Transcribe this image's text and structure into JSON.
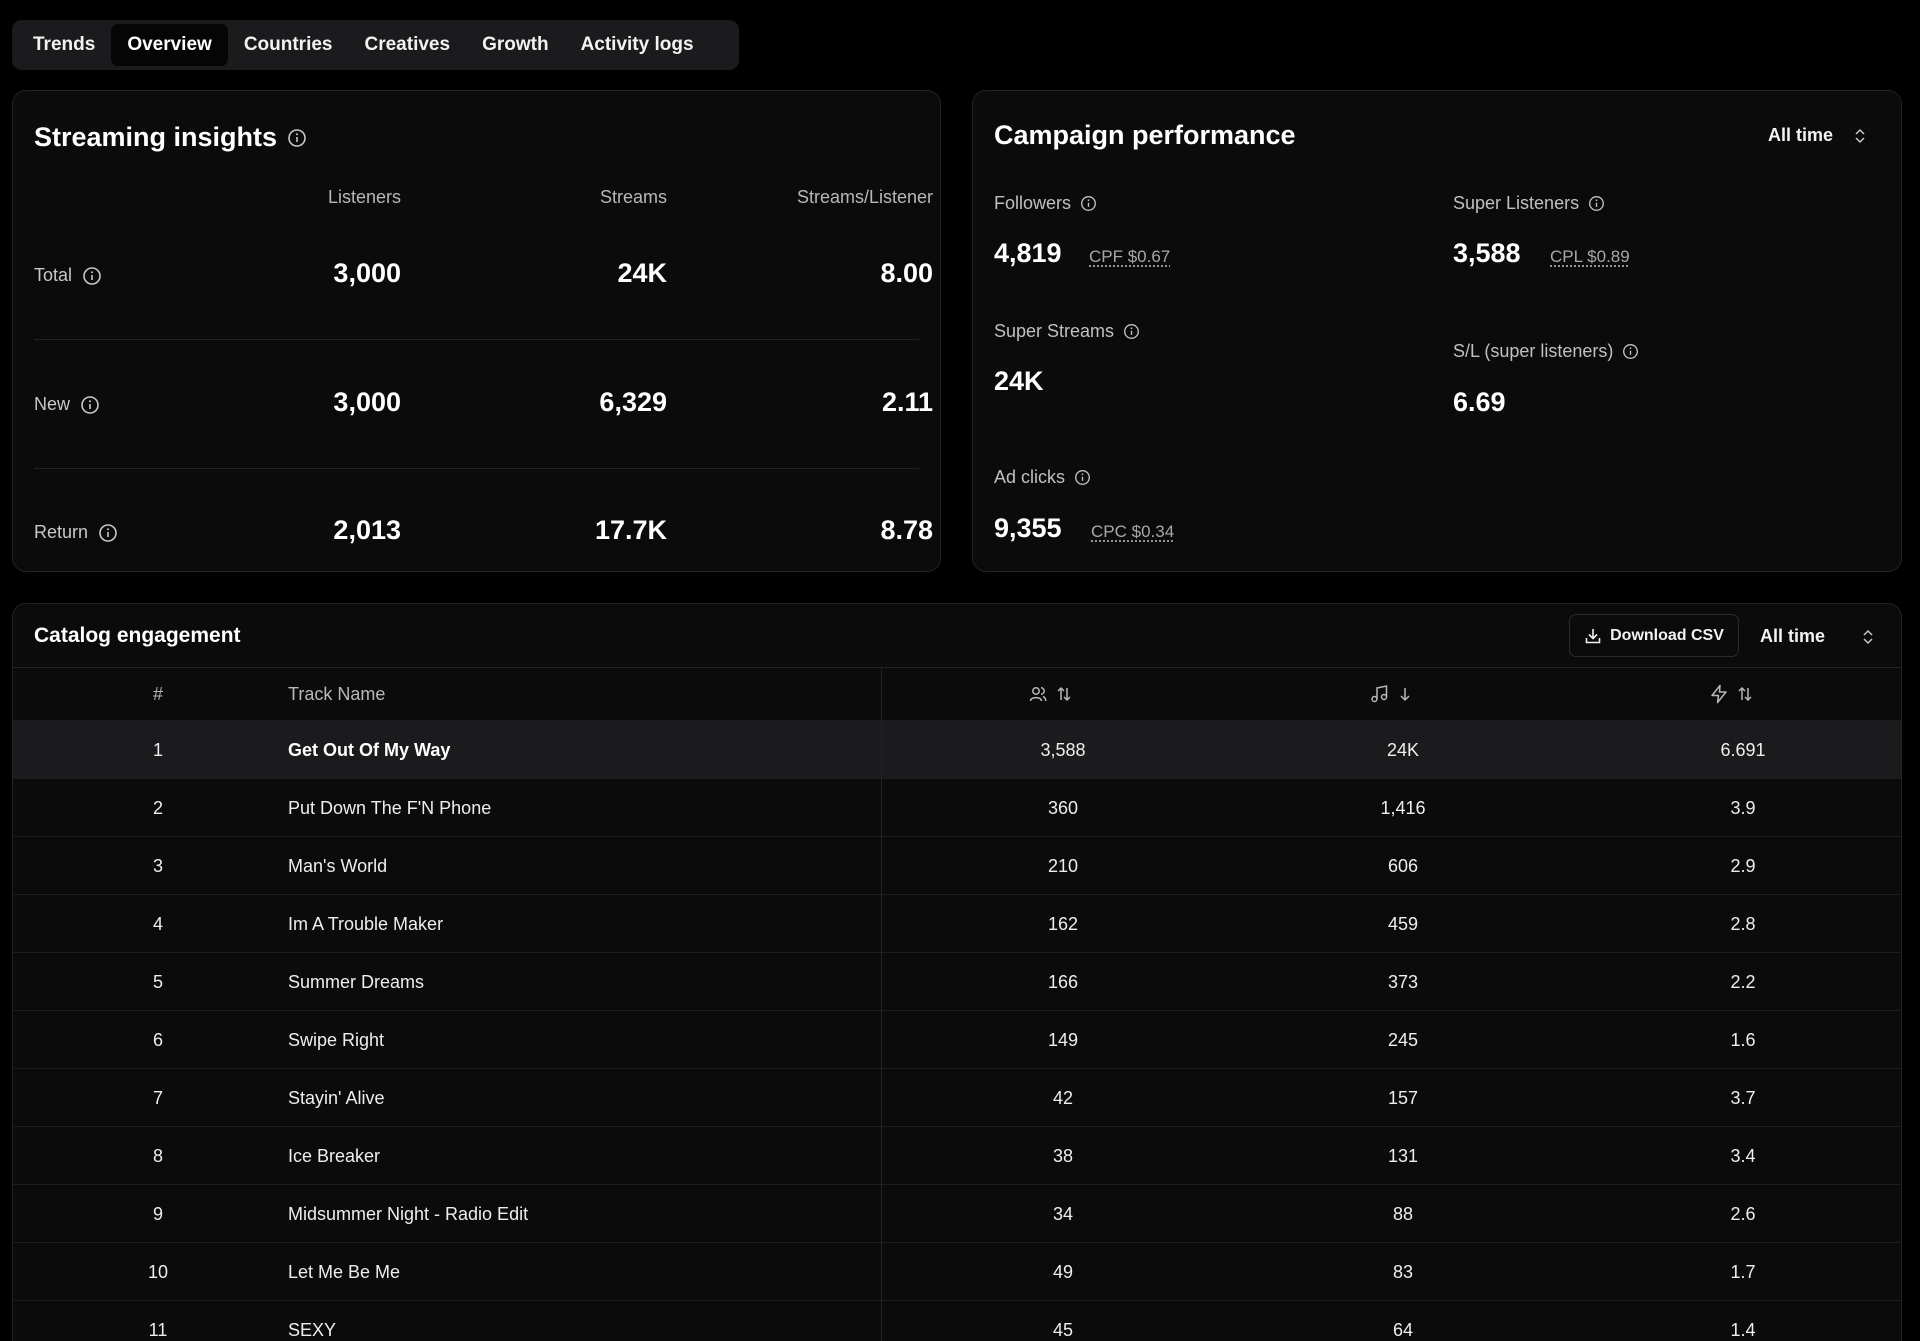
{
  "tabs": [
    {
      "label": "Trends",
      "active": false
    },
    {
      "label": "Overview",
      "active": true
    },
    {
      "label": "Countries",
      "active": false
    },
    {
      "label": "Creatives",
      "active": false
    },
    {
      "label": "Growth",
      "active": false
    },
    {
      "label": "Activity logs",
      "active": false
    }
  ],
  "streaming": {
    "title": "Streaming insights",
    "columns": [
      "Listeners",
      "Streams",
      "Streams/Listener"
    ],
    "rows": [
      {
        "label": "Total",
        "values": [
          "3,000",
          "24K",
          "8.00"
        ]
      },
      {
        "label": "New",
        "values": [
          "3,000",
          "6,329",
          "2.11"
        ]
      },
      {
        "label": "Return",
        "values": [
          "2,013",
          "17.7K",
          "8.78"
        ]
      }
    ]
  },
  "campaign": {
    "title": "Campaign performance",
    "period": "All time",
    "followers": {
      "label": "Followers",
      "value": "4,819",
      "sub": "CPF $0.67"
    },
    "super_listeners": {
      "label": "Super Listeners",
      "value": "3,588",
      "sub": "CPL $0.89"
    },
    "super_streams": {
      "label": "Super Streams",
      "value": "24K"
    },
    "sl_ratio": {
      "label": "S/L (super listeners)",
      "value": "6.69"
    },
    "ad_clicks": {
      "label": "Ad clicks",
      "value": "9,355",
      "sub": "CPC $0.34"
    }
  },
  "catalog": {
    "title": "Catalog engagement",
    "download_label": "Download CSV",
    "period": "All time",
    "headers": {
      "num": "#",
      "name": "Track Name"
    },
    "header_icons": [
      "users-icon",
      "music-note-icon",
      "lightning-icon"
    ],
    "rows": [
      {
        "num": "1",
        "name": "Get Out Of My Way",
        "listeners": "3,588",
        "streams": "24K",
        "ratio": "6.691"
      },
      {
        "num": "2",
        "name": "Put Down The F'N Phone",
        "listeners": "360",
        "streams": "1,416",
        "ratio": "3.9"
      },
      {
        "num": "3",
        "name": "Man's World",
        "listeners": "210",
        "streams": "606",
        "ratio": "2.9"
      },
      {
        "num": "4",
        "name": "Im A Trouble Maker",
        "listeners": "162",
        "streams": "459",
        "ratio": "2.8"
      },
      {
        "num": "5",
        "name": "Summer Dreams",
        "listeners": "166",
        "streams": "373",
        "ratio": "2.2"
      },
      {
        "num": "6",
        "name": "Swipe Right",
        "listeners": "149",
        "streams": "245",
        "ratio": "1.6"
      },
      {
        "num": "7",
        "name": "Stayin' Alive",
        "listeners": "42",
        "streams": "157",
        "ratio": "3.7"
      },
      {
        "num": "8",
        "name": "Ice Breaker",
        "listeners": "38",
        "streams": "131",
        "ratio": "3.4"
      },
      {
        "num": "9",
        "name": "Midsummer Night - Radio Edit",
        "listeners": "34",
        "streams": "88",
        "ratio": "2.6"
      },
      {
        "num": "10",
        "name": "Let Me Be Me",
        "listeners": "49",
        "streams": "83",
        "ratio": "1.7"
      },
      {
        "num": "11",
        "name": "SEXY",
        "listeners": "45",
        "streams": "64",
        "ratio": "1.4"
      }
    ]
  },
  "colors": {
    "background": "#000000",
    "card": "#0b0b0b",
    "border": "#232325",
    "highlight_row": "#1b1b1d",
    "text": "#ffffff",
    "muted": "#b8b8bc"
  }
}
